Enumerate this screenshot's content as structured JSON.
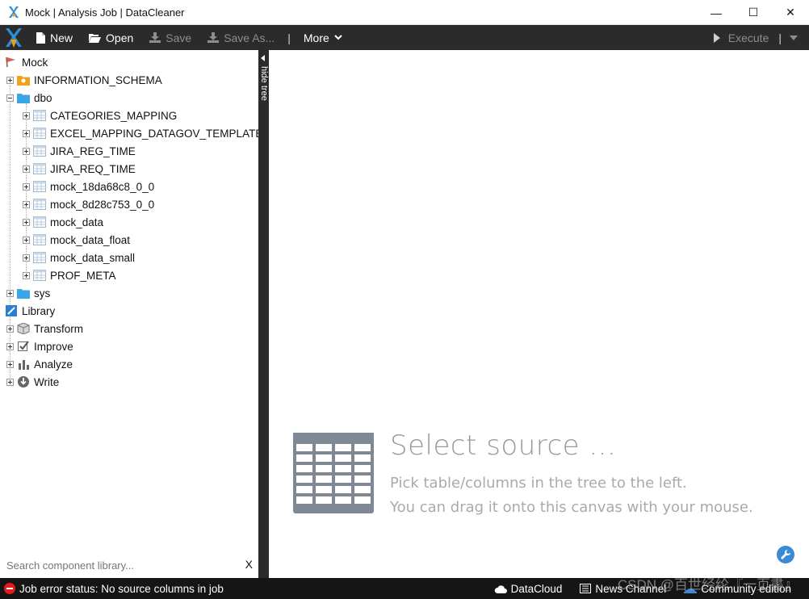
{
  "window": {
    "title": "Mock | Analysis Job | DataCleaner",
    "controls": {
      "minimize": "—",
      "maximize": "☐",
      "close": "✕"
    }
  },
  "toolbar": {
    "new_label": "New",
    "open_label": "Open",
    "save_label": "Save",
    "save_as_label": "Save As...",
    "more_label": "More",
    "separator": "|",
    "execute_label": "Execute"
  },
  "tree": {
    "root": "Mock",
    "schemas": {
      "information_schema": "INFORMATION_SCHEMA",
      "dbo": "dbo",
      "sys": "sys"
    },
    "tables": [
      "CATEGORIES_MAPPING",
      "EXCEL_MAPPING_DATAGOV_TEMPLATE",
      "JIRA_REG_TIME",
      "JIRA_REQ_TIME",
      "mock_18da68c8_0_0",
      "mock_8d28c753_0_0",
      "mock_data",
      "mock_data_float",
      "mock_data_small",
      "PROF_META"
    ],
    "library": "Library",
    "library_items": [
      "Transform",
      "Improve",
      "Analyze",
      "Write"
    ]
  },
  "hide_tree_label": "hide tree",
  "search": {
    "placeholder": "Search component library...",
    "clear_label": "X"
  },
  "canvas": {
    "title": "Select source ...",
    "line1": "Pick table/columns in the tree to the left.",
    "line2": "You can drag it onto this canvas with your mouse."
  },
  "status": {
    "error_text": "Job error status: No source columns in job",
    "datacloud": "DataCloud",
    "news_channel": "News Channel",
    "community_edition": "Community edition",
    "watermark": "CSDN @百世经纶『一页書』"
  },
  "colors": {
    "toolbar_bg": "#2b2b2b",
    "status_bg": "#151515",
    "error_red": "#e21b1b",
    "folder_blue": "#3aa6e8",
    "accent_blue": "#3a8ad6"
  }
}
